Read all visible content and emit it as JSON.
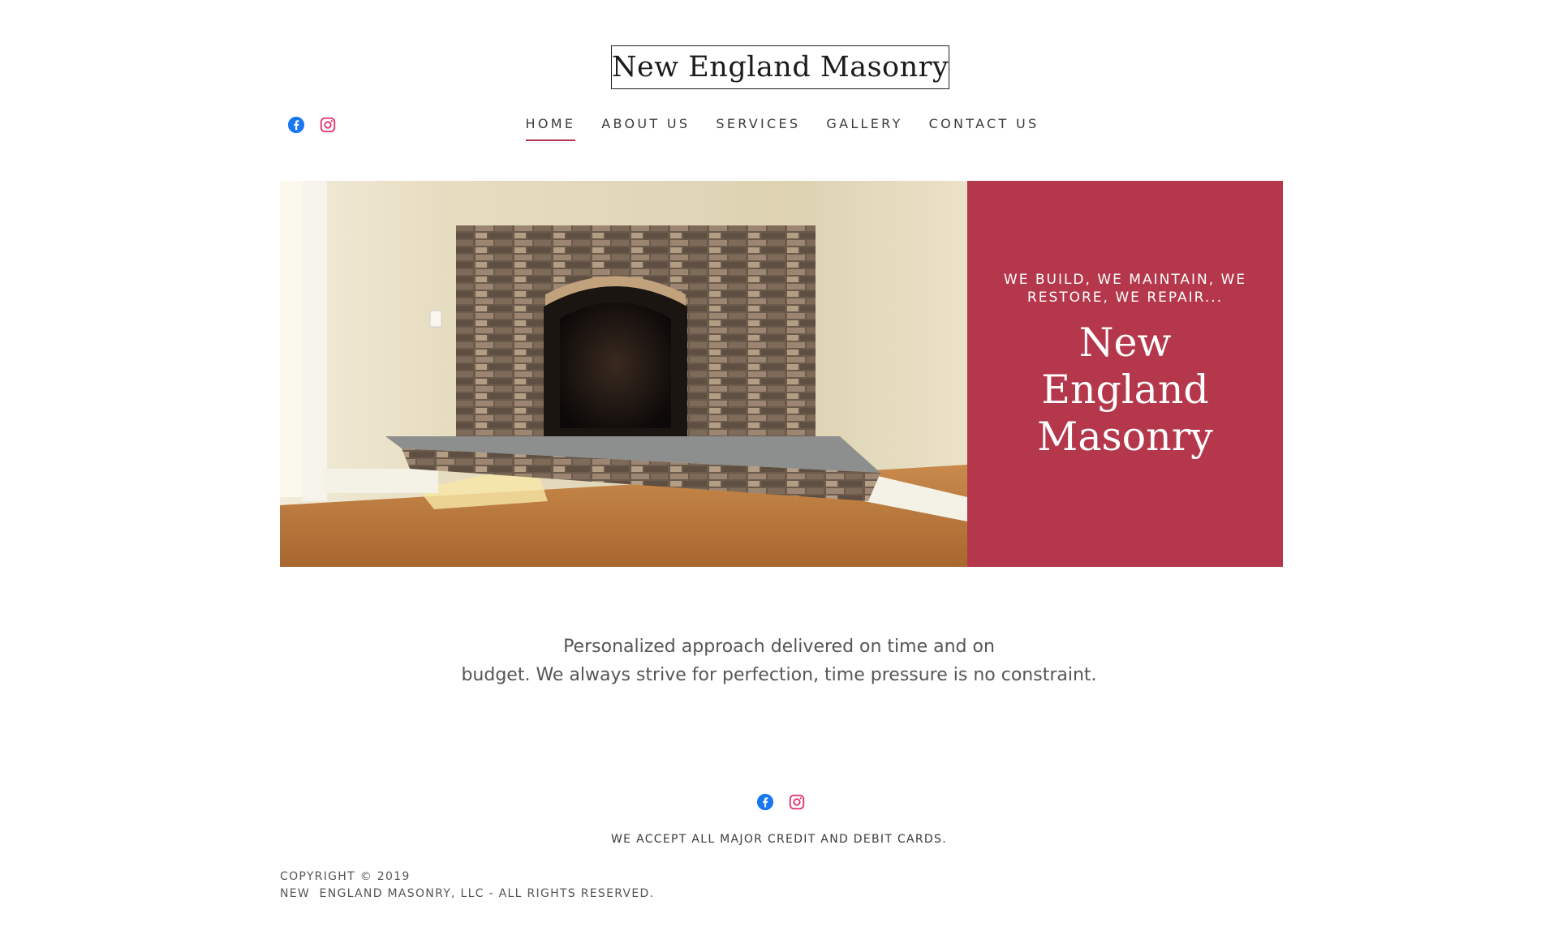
{
  "header": {
    "logo_text": "New England Masonry",
    "social": [
      "facebook-icon",
      "instagram-icon"
    ]
  },
  "nav": {
    "items": [
      {
        "label": "HOME",
        "active": true
      },
      {
        "label": "ABOUT US",
        "active": false
      },
      {
        "label": "SERVICES",
        "active": false
      },
      {
        "label": "GALLERY",
        "active": false
      },
      {
        "label": "CONTACT US",
        "active": false
      }
    ]
  },
  "hero": {
    "image_description_icon": "fireplace-photo",
    "tagline": "WE BUILD, WE MAINTAIN, WE RESTORE, WE REPAIR...",
    "title_line1": "New England",
    "title_line2": "Masonry"
  },
  "intro": {
    "line1": "Personalized approach delivered on time and on",
    "line2": "budget. We always strive for perfection, time pressure is no constraint."
  },
  "footer": {
    "cards_note": "WE ACCEPT ALL MAJOR CREDIT AND DEBIT CARDS.",
    "copyright_line1": "COPYRIGHT © 2019",
    "copyright_line2": "NEW  ENGLAND MASONRY, LLC - ALL RIGHTS RESERVED."
  },
  "colors": {
    "accent": "#b5374b",
    "facebook": "#1877f2",
    "instagram": "#e1306c"
  }
}
